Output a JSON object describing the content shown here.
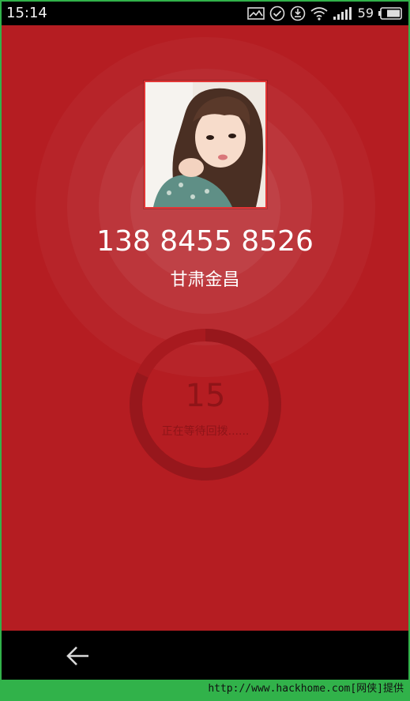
{
  "status_bar": {
    "time": "15:14",
    "battery_percent": "59",
    "icons": [
      "image-icon",
      "check-circle-icon",
      "sync-icon",
      "wifi-icon",
      "signal-icon",
      "battery-icon"
    ]
  },
  "call": {
    "phone_number": "138 8455 8526",
    "location": "甘肃金昌",
    "countdown": "15",
    "status_text": "正在等待回拨......",
    "progress": 0.82
  },
  "nav": {
    "back_icon": "back-arrow-icon"
  },
  "watermark": {
    "text": "http://www.hackhome.com[网侠]提供"
  },
  "colors": {
    "background_red": "#b51d22",
    "ring_dark_red": "#8f1418",
    "frame_green": "#31b24a"
  }
}
